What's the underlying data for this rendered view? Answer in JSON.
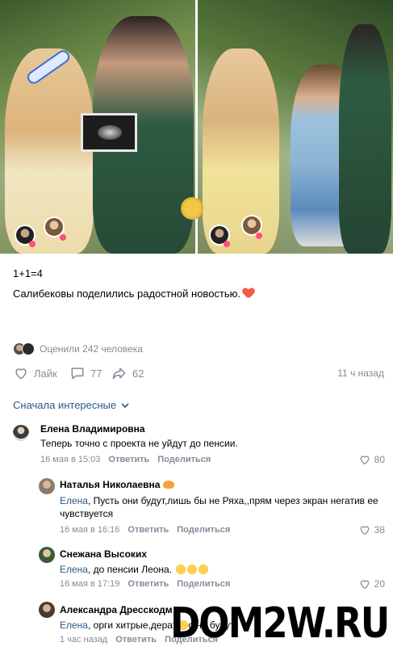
{
  "post": {
    "line1": "1+1=4",
    "line2": "Салибековы поделились радостной новостью.",
    "line2_emoji": "heart-icon",
    "rated_text": "Оценили 242 человека",
    "likes_label": "Лайк",
    "comments_count": "77",
    "shares_count": "62",
    "time_ago": "11 ч назад"
  },
  "sort": {
    "label": "Сначала интересные"
  },
  "comments": [
    {
      "name": "Елена Владимировна",
      "text": "Теперь точно с проекта не уйдут до пенсии.",
      "date": "16 мая в 15:03",
      "reply": "Ответить",
      "share": "Поделиться",
      "likes": "80"
    },
    {
      "name": "Наталья Николаевна",
      "reply_to": "Елена",
      "text": ", Пусть они будут,лишь бы не Ряха,,прям через экран негатив ее чувствуется",
      "date": "16 мая в 16:16",
      "reply": "Ответить",
      "share": "Поделиться",
      "likes": "38"
    },
    {
      "name": "Снежана Высоких",
      "reply_to": "Елена",
      "text": ", до пенсии Леона.",
      "date": "16 мая в 17:19",
      "reply": "Ответить",
      "share": "Поделиться",
      "likes": "20"
    },
    {
      "name": "Александра Дресскодм",
      "reply_to": "Елена",
      "text": ", орги хитрые,дер",
      "text_tail": "ат",
      "text_tail2": "о",
      "text_end": ",не будут",
      "date": "1 час назад",
      "reply": "Ответить",
      "share": "Поделиться"
    }
  ],
  "watermark": "DOM2W.RU",
  "colors": {
    "link": "#2a5885",
    "muted": "#818c99",
    "heart": "#f25c3f"
  }
}
